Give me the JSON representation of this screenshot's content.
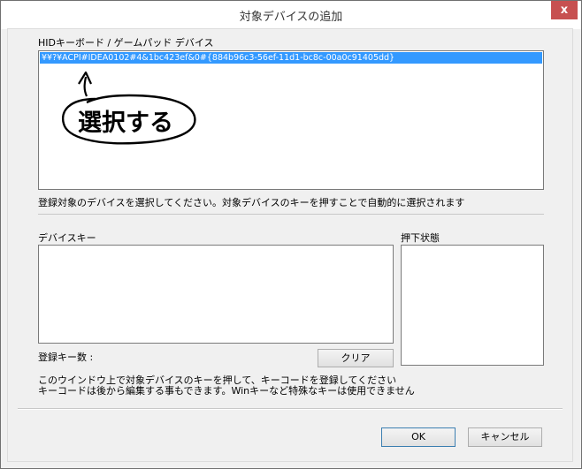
{
  "window": {
    "title": "対象デバイスの追加",
    "close_glyph": "x"
  },
  "device_section": {
    "label": "HIDキーボード / ゲームパッド デバイス",
    "devices": [
      "¥¥?¥ACPI#IDEA0102#4&1bc423ef&0#{884b96c3-56ef-11d1-bc8c-00a0c91405dd}"
    ],
    "selected_index": 0,
    "help_text": "登録対象のデバイスを選択してください。対象デバイスのキーを押すことで自動的に選択されます"
  },
  "annotation": {
    "text": "選択する"
  },
  "device_keys_section": {
    "label": "デバイスキー",
    "count_label": "登録キー数 :",
    "clear_button": "クリア"
  },
  "pressed_state_section": {
    "label": "押下状態"
  },
  "instructions": {
    "line1": "このウインドウ上で対象デバイスのキーを押して、キーコードを登録してください",
    "line2": "キーコードは後から編集する事もできます。Winキーなど特殊なキーは使用できません"
  },
  "buttons": {
    "ok": "OK",
    "cancel": "キャンセル"
  },
  "colors": {
    "selection": "#3399ff",
    "close_button": "#c75050"
  }
}
